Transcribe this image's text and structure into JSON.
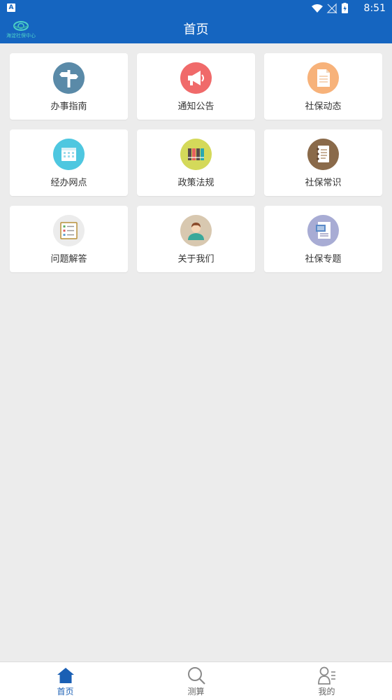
{
  "status_bar": {
    "left_badge": "A",
    "time": "8:51"
  },
  "header": {
    "logo_text": "海淀社保中心",
    "title": "首页"
  },
  "tiles": [
    {
      "label": "办事指南",
      "icon": "signpost-icon",
      "color": "#5a8aa8"
    },
    {
      "label": "通知公告",
      "icon": "megaphone-icon",
      "color": "#f06a6a"
    },
    {
      "label": "社保动态",
      "icon": "document-icon",
      "color": "#f7b27a"
    },
    {
      "label": "经办网点",
      "icon": "calendar-icon",
      "color": "#4ec7e0"
    },
    {
      "label": "政策法规",
      "icon": "binders-icon",
      "color": "#d4d95a"
    },
    {
      "label": "社保常识",
      "icon": "notebook-icon",
      "color": "#8a6a4a"
    },
    {
      "label": "问题解答",
      "icon": "checklist-icon",
      "color": "#ececec"
    },
    {
      "label": "关于我们",
      "icon": "person-icon",
      "color": "#d8c8b0"
    },
    {
      "label": "社保专题",
      "icon": "slides-icon",
      "color": "#a8acd4"
    }
  ],
  "tabbar": {
    "items": [
      {
        "label": "首页",
        "icon": "home-icon",
        "active": true
      },
      {
        "label": "测算",
        "icon": "search-icon",
        "active": false
      },
      {
        "label": "我的",
        "icon": "profile-icon",
        "active": false
      }
    ],
    "active_color": "#1a5fb4"
  }
}
